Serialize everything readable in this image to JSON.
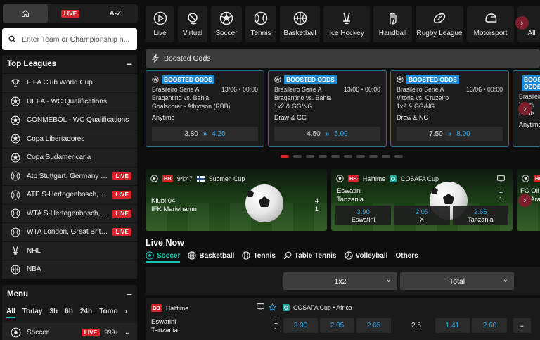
{
  "topnav": {
    "live": "LIVE",
    "az": "A-Z"
  },
  "search": {
    "placeholder": "Enter Team or Championship n..."
  },
  "top_leagues": {
    "title": "Top Leagues",
    "items": [
      {
        "name": "FIFA Club World Cup",
        "icon": "trophy-icon",
        "live": ""
      },
      {
        "name": "UEFA - WC Qualifications",
        "icon": "soccer-icon",
        "live": ""
      },
      {
        "name": "CONMEBOL - WC Qualifications",
        "icon": "soccer-icon",
        "live": ""
      },
      {
        "name": "Copa Libertadores",
        "icon": "soccer-icon",
        "live": ""
      },
      {
        "name": "Copa Sudamericana",
        "icon": "soccer-icon",
        "live": ""
      },
      {
        "name": "Atp Stuttgart, Germany M...",
        "icon": "tennis-icon",
        "live": "LIVE"
      },
      {
        "name": "ATP S-Hertogenbosch, Ne...",
        "icon": "tennis-icon",
        "live": "LIVE"
      },
      {
        "name": "WTA S-Hertogenbosch, Ne...",
        "icon": "tennis-icon",
        "live": "LIVE"
      },
      {
        "name": "WTA London, Great Britai...",
        "icon": "tennis-icon",
        "live": "LIVE"
      },
      {
        "name": "NHL",
        "icon": "hockey-icon",
        "live": ""
      },
      {
        "name": "NBA",
        "icon": "basketball-icon",
        "live": ""
      }
    ]
  },
  "menu": {
    "title": "Menu",
    "tabs": [
      "All",
      "Today",
      "3h",
      "6h",
      "24h",
      "Tomo"
    ],
    "row": {
      "name": "Soccer",
      "live": "LIVE",
      "count": "999+"
    }
  },
  "sports": [
    {
      "label": "Live",
      "icon": "play-icon"
    },
    {
      "label": "Virtual",
      "icon": "virtual-icon"
    },
    {
      "label": "Soccer",
      "icon": "soccer-icon"
    },
    {
      "label": "Tennis",
      "icon": "tennis-icon"
    },
    {
      "label": "Basketball",
      "icon": "basketball-icon"
    },
    {
      "label": "Ice Hockey",
      "icon": "hockey-icon"
    },
    {
      "label": "Handball",
      "icon": "handball-icon"
    },
    {
      "label": "Rugby League",
      "icon": "rugby-icon"
    },
    {
      "label": "Motorsport",
      "icon": "helmet-icon"
    },
    {
      "label": "All",
      "icon": "all-icon"
    }
  ],
  "boosted": {
    "title": "Boosted Odds",
    "tag": "BOOSTED ODDS",
    "cards": [
      {
        "competition": "Brasileiro Serie A",
        "datetime": "13/06 • 00:00",
        "match": "Bragantino vs. Bahia",
        "detail": "Goalscorer - Athyrson (RBB)",
        "market": "Anytime",
        "old": "3.80",
        "new": "4.20"
      },
      {
        "competition": "Brasileiro Serie A",
        "datetime": "13/06 • 00:00",
        "match": "Bragantino vs. Bahia",
        "detail": "1x2 & GG/NG",
        "market": "Draw & GG",
        "old": "4.50",
        "new": "5.00"
      },
      {
        "competition": "Brasileiro Serie A",
        "datetime": "13/06 • 00:00",
        "match": "Vitoria vs. Cruzeiro",
        "detail": "1x2 & GG/NG",
        "market": "Draw & NG",
        "old": "7.50",
        "new": "8.00"
      },
      {
        "competition": "Brasileiro Serie A",
        "datetime": "",
        "match": "Vitoria vs. Cru",
        "detail": "Goalscor",
        "market": "Anytime",
        "old": "",
        "new": ""
      }
    ]
  },
  "live_cards": [
    {
      "badge": "BB",
      "clock": "94:47",
      "competition": "Suomen Cup",
      "home": "Klubi 04",
      "away": "IFK Mariehamn",
      "home_score": "4",
      "away_score": "1"
    },
    {
      "badge": "BB",
      "clock": "Halftime",
      "competition": "COSAFA Cup",
      "home": "Eswatini",
      "away": "Tanzania",
      "home_score": "1",
      "away_score": "1",
      "odds": [
        {
          "v": "3.90",
          "l": "Eswatini"
        },
        {
          "v": "2.05",
          "l": "X"
        },
        {
          "v": "2.65",
          "l": "Tanzania"
        }
      ]
    },
    {
      "badge": "BB",
      "clock": "",
      "competition": "",
      "home": "FC Oli",
      "away": "FK Ara",
      "home_score": "",
      "away_score": ""
    }
  ],
  "live_now": {
    "title": "Live Now",
    "tabs": [
      "Soccer",
      "Basketball",
      "Tennis",
      "Table Tennis",
      "Volleyball",
      "Others"
    ],
    "select_market": "1x2",
    "select_total": "Total",
    "event": {
      "badge": "BB",
      "status": "Halftime",
      "competition": "COSAFA Cup • Africa",
      "home": "Eswatini",
      "away": "Tanzania",
      "home_score": "1",
      "away_score": "1",
      "odds_1x2": [
        "3.90",
        "2.05",
        "2.65"
      ],
      "line": "2.5",
      "odds_total": [
        "1.41",
        "2.60"
      ]
    }
  },
  "colors": {
    "accent": "#19c3b0",
    "live_red": "#d8232a",
    "boost_blue": "#1f8bd6",
    "odds_blue": "#38a7e8"
  }
}
